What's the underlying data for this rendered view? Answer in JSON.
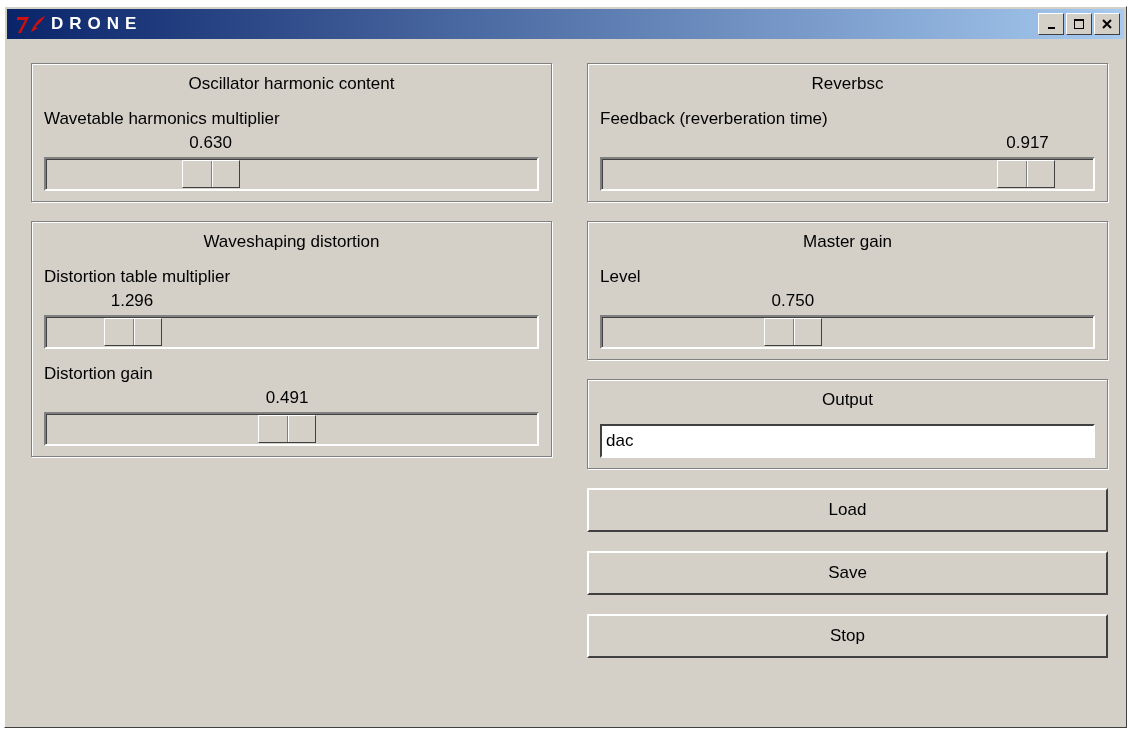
{
  "window": {
    "title": "DRONE"
  },
  "left_column": [
    {
      "kind": "sliders",
      "title": "Oscillator harmonic content",
      "sliders": [
        {
          "label": "Wavetable harmonics multiplier",
          "reading": "0.630",
          "level": 0.315
        }
      ]
    },
    {
      "kind": "sliders",
      "title": "Waveshaping distortion",
      "sliders": [
        {
          "label": "Distortion table multiplier",
          "reading": "1.296",
          "level": 0.135
        },
        {
          "label": "Distortion gain",
          "reading": "0.491",
          "level": 0.49
        }
      ]
    }
  ],
  "right_column": [
    {
      "kind": "sliders",
      "title": "Reverbsc",
      "sliders": [
        {
          "label": "Feedback (reverberation time)",
          "reading": "0.917",
          "level": 0.912
        }
      ]
    },
    {
      "kind": "sliders",
      "title": "Master gain",
      "sliders": [
        {
          "label": "Level",
          "reading": "0.750",
          "level": 0.375
        }
      ]
    },
    {
      "kind": "entry",
      "title": "Output",
      "value": "dac"
    }
  ],
  "buttons": [
    "Load",
    "Save",
    "Stop"
  ]
}
